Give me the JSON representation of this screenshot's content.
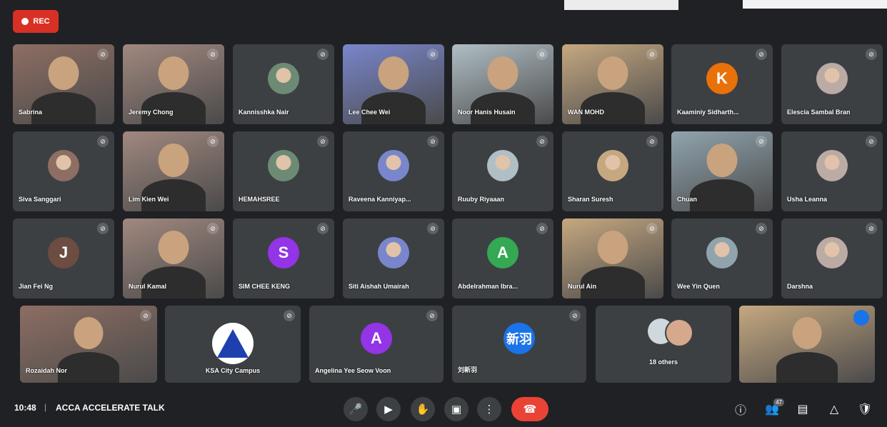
{
  "recording": {
    "label": "REC"
  },
  "participants_row1": [
    {
      "name": "Sabrina",
      "type": "video"
    },
    {
      "name": "Jeremy Chong",
      "type": "video"
    },
    {
      "name": "Kannisshka Nair",
      "type": "photo"
    },
    {
      "name": "Lee Chee Wei",
      "type": "video"
    },
    {
      "name": "Noor Hanis Husain",
      "type": "video"
    },
    {
      "name": "WAN MOHD",
      "type": "video"
    },
    {
      "name": "Kaaminiy Sidharth...",
      "type": "initial",
      "initial": "K",
      "color": "#e8710a"
    },
    {
      "name": "Elescia Sambal Bran",
      "type": "photo"
    }
  ],
  "participants_row2": [
    {
      "name": "Siva Sanggari",
      "type": "photo"
    },
    {
      "name": "Lim Kien Wei",
      "type": "video"
    },
    {
      "name": "HEMAHSREE",
      "type": "photo"
    },
    {
      "name": "Raveena Kanniyap...",
      "type": "photo"
    },
    {
      "name": "Ruuby Riyaaan",
      "type": "photo"
    },
    {
      "name": "Sharan Suresh",
      "type": "photo"
    },
    {
      "name": "Chuan",
      "type": "video"
    },
    {
      "name": "Usha Leanna",
      "type": "photo"
    }
  ],
  "participants_row3": [
    {
      "name": "Jian Fei Ng",
      "type": "initial",
      "initial": "J",
      "color": "#6d4c41"
    },
    {
      "name": "Nurul Kamal",
      "type": "video"
    },
    {
      "name": "SIM CHEE KENG",
      "type": "initial",
      "initial": "S",
      "color": "#9334e6"
    },
    {
      "name": "Siti Aishah Umairah",
      "type": "photo"
    },
    {
      "name": "Abdelrahman Ibra...",
      "type": "initial",
      "initial": "A",
      "color": "#34a853"
    },
    {
      "name": "Nurul Ain",
      "type": "video"
    },
    {
      "name": "Wee Yin Quen",
      "type": "photo"
    },
    {
      "name": "Darshna",
      "type": "photo"
    }
  ],
  "participants_row4": [
    {
      "name": "Rozaidah Nor",
      "type": "video"
    },
    {
      "name": "KSA City Campus",
      "type": "logo"
    },
    {
      "name": "Angelina Yee Seow Voon",
      "type": "initial",
      "initial": "A",
      "color": "#9334e6"
    },
    {
      "name": "刘新羽",
      "type": "initial",
      "initial": "新羽",
      "color": "#1a73e8"
    },
    {
      "name": "18 others",
      "type": "others"
    },
    {
      "name": "",
      "type": "self"
    }
  ],
  "bottombar": {
    "time": "10:48",
    "separator": "|",
    "meeting_title": "ACCA ACCELERATE TALK",
    "people_count": "47"
  },
  "colors": {
    "background": "#202124",
    "tile": "#3c4043",
    "end_call": "#ea4335",
    "rec": "#d93025",
    "active_speaker_border": "#8ab4f8"
  },
  "icons": {
    "mute": "mic-off-icon",
    "mic": "mic-icon",
    "camera": "camera-icon",
    "hand": "raise-hand-icon",
    "present": "present-screen-icon",
    "more": "more-options-icon",
    "end": "end-call-icon",
    "info": "info-icon",
    "people": "people-icon",
    "chat": "chat-icon",
    "activities": "activities-icon",
    "host": "host-controls-icon"
  }
}
